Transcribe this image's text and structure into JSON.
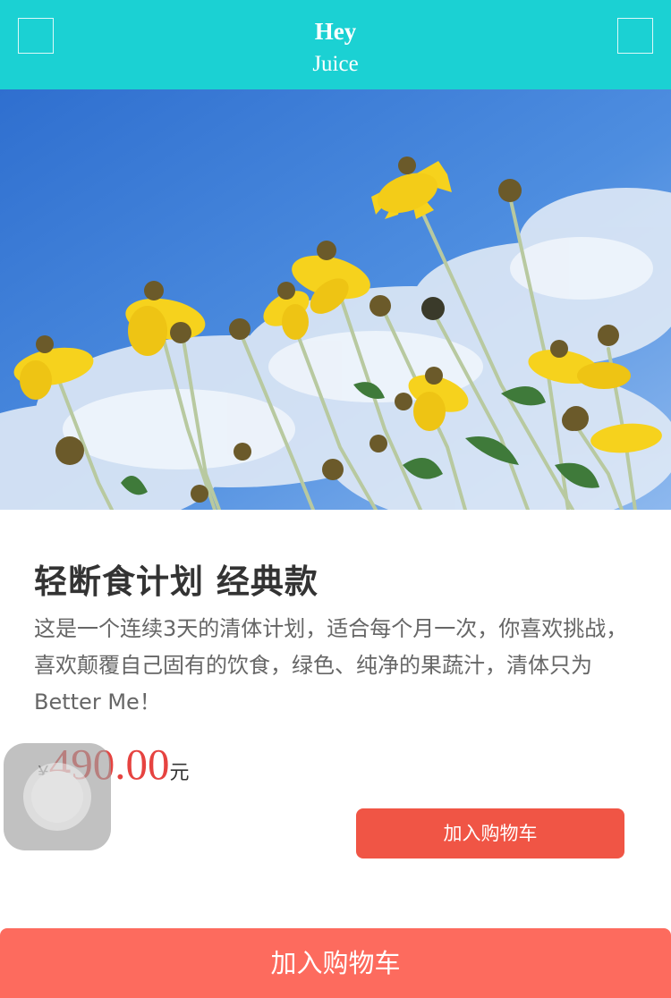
{
  "header": {
    "brand_top": "Hey",
    "brand_bottom": "Juice",
    "colors": {
      "background": "#1bd1d3"
    }
  },
  "banner": {
    "slide_count": 5,
    "active_slide": 2
  },
  "product": {
    "title": "轻断食计划 经典款",
    "description": "这是一个连续3天的清体计划，适合每个月一次，你喜欢挑战，喜欢颠覆自己固有的饮食，绿色、纯净的果蔬汁，清体只为Better Me！",
    "currency_symbol": "¥",
    "price": "490.00",
    "price_unit": "元",
    "price_color": "#e64340"
  },
  "actions": {
    "add_to_cart_inline": "加入购物车",
    "add_to_cart_bottom": "加入购物车",
    "colors": {
      "inline_button": "#f05545",
      "bottom_button": "#fd6b5e"
    }
  }
}
